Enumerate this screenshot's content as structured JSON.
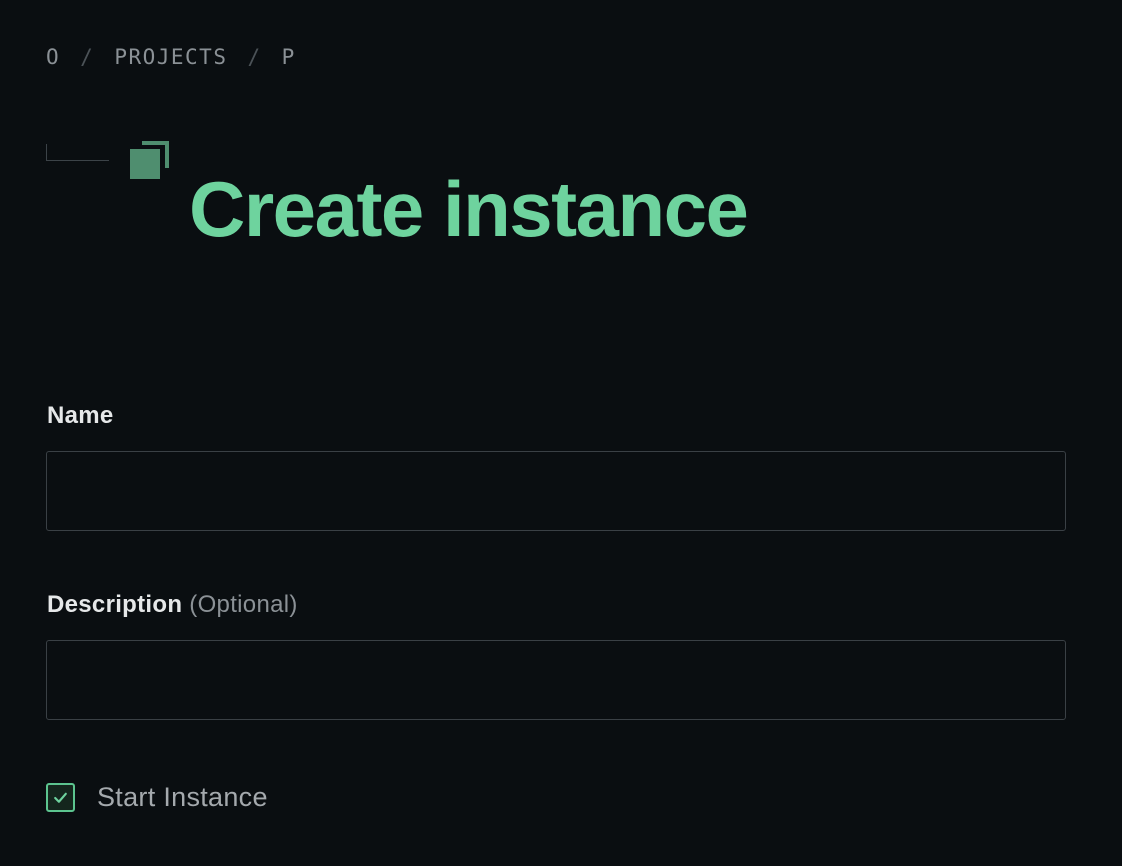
{
  "breadcrumb": {
    "items": [
      "O",
      "PROJECTS",
      "P"
    ],
    "separator": "/"
  },
  "header": {
    "title": "Create instance",
    "icon": "instances-icon",
    "accent_color": "#6ed39e"
  },
  "form": {
    "name": {
      "label": "Name",
      "value": "",
      "placeholder": ""
    },
    "description": {
      "label": "Description",
      "optional_label": "(Optional)",
      "value": "",
      "placeholder": ""
    },
    "start_instance": {
      "label": "Start Instance",
      "checked": true
    }
  }
}
